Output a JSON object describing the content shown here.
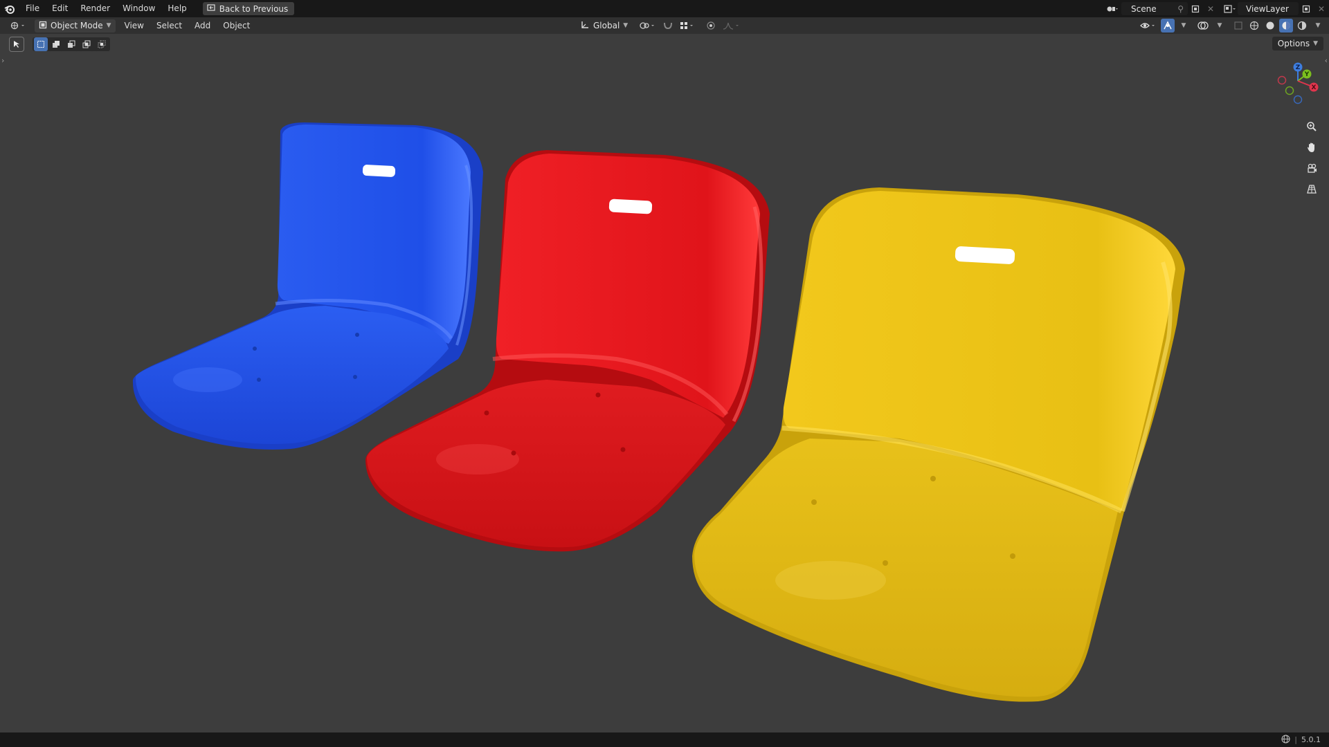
{
  "topbar": {
    "menus": [
      "File",
      "Edit",
      "Render",
      "Window",
      "Help"
    ],
    "back_button": "Back to Previous",
    "scene_name": "Scene",
    "view_layer": "ViewLayer"
  },
  "header": {
    "mode": "Object Mode",
    "menus": [
      "View",
      "Select",
      "Add",
      "Object"
    ],
    "orientation": "Global"
  },
  "viewport": {
    "options_label": "Options",
    "gizmo_axes": [
      "Z",
      "Y",
      "X"
    ],
    "objects": [
      {
        "name": "blue-seat",
        "color": "#1f4fe8"
      },
      {
        "name": "red-seat",
        "color": "#e8141a"
      },
      {
        "name": "yellow-seat",
        "color": "#eec414"
      }
    ]
  },
  "statusbar": {
    "version": "5.0.1"
  },
  "colors": {
    "topbar_bg": "#181818",
    "header_bg": "#303030",
    "viewport_bg": "#3d3d3d",
    "accent_blue": "#4772b3"
  }
}
